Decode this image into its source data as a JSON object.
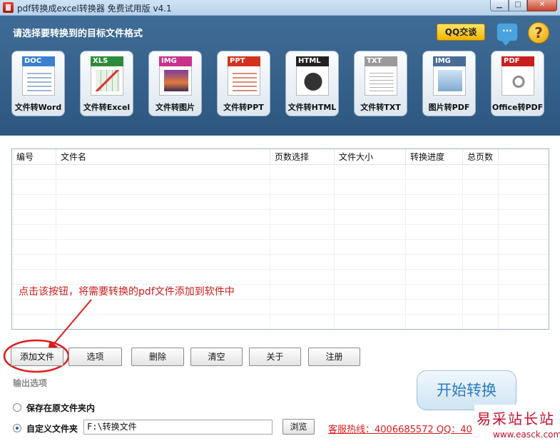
{
  "window": {
    "title": "pdf转换成excel转换器 免费试用版 v4.1",
    "buttons": [
      "▁",
      "□",
      "✕"
    ]
  },
  "header": {
    "prompt": "请选择要转换到的目标文件格式",
    "qq_label": "QQ交谈",
    "help_glyph": "?",
    "chat_glyph": "···"
  },
  "tools": [
    {
      "tag": "DOC",
      "label": "文件转Word",
      "color": "#3a7fd0"
    },
    {
      "tag": "XLS",
      "label": "文件转Excel",
      "color": "#2e8b3a"
    },
    {
      "tag": "IMG",
      "label": "文件转图片",
      "color": "#c8328a"
    },
    {
      "tag": "PPT",
      "label": "文件转PPT",
      "color": "#d2321e"
    },
    {
      "tag": "HTML",
      "label": "文件转HTML",
      "color": "#222222"
    },
    {
      "tag": "TXT",
      "label": "文件转TXT",
      "color": "#9a9a9a"
    },
    {
      "tag": "IMG",
      "label": "图片转PDF",
      "color": "#4a6d96"
    },
    {
      "tag": "PDF",
      "label": "Office转PDF",
      "color": "#c91f1f"
    }
  ],
  "table": {
    "columns": [
      "编号",
      "文件名",
      "页数选择",
      "文件大小",
      "转换进度",
      "总页数",
      ""
    ]
  },
  "annotation": "点击该按钮，将需要转换的pdf文件添加到软件中",
  "toolbar": {
    "add": "添加文件",
    "options": "选项",
    "delete": "删除",
    "clear": "清空",
    "about": "关于",
    "register": "注册"
  },
  "output": {
    "title": "输出选项",
    "option_original": "保存在原文件夹内",
    "option_custom": "自定义文件夹",
    "path": "F:\\转换文件",
    "browse": "浏览",
    "selected": "custom"
  },
  "start_label": "开始转换",
  "hotline": "客服热线：4006685572 QQ：40",
  "watermark": {
    "main": "易采站长站",
    "sub": "www.easck.com"
  }
}
